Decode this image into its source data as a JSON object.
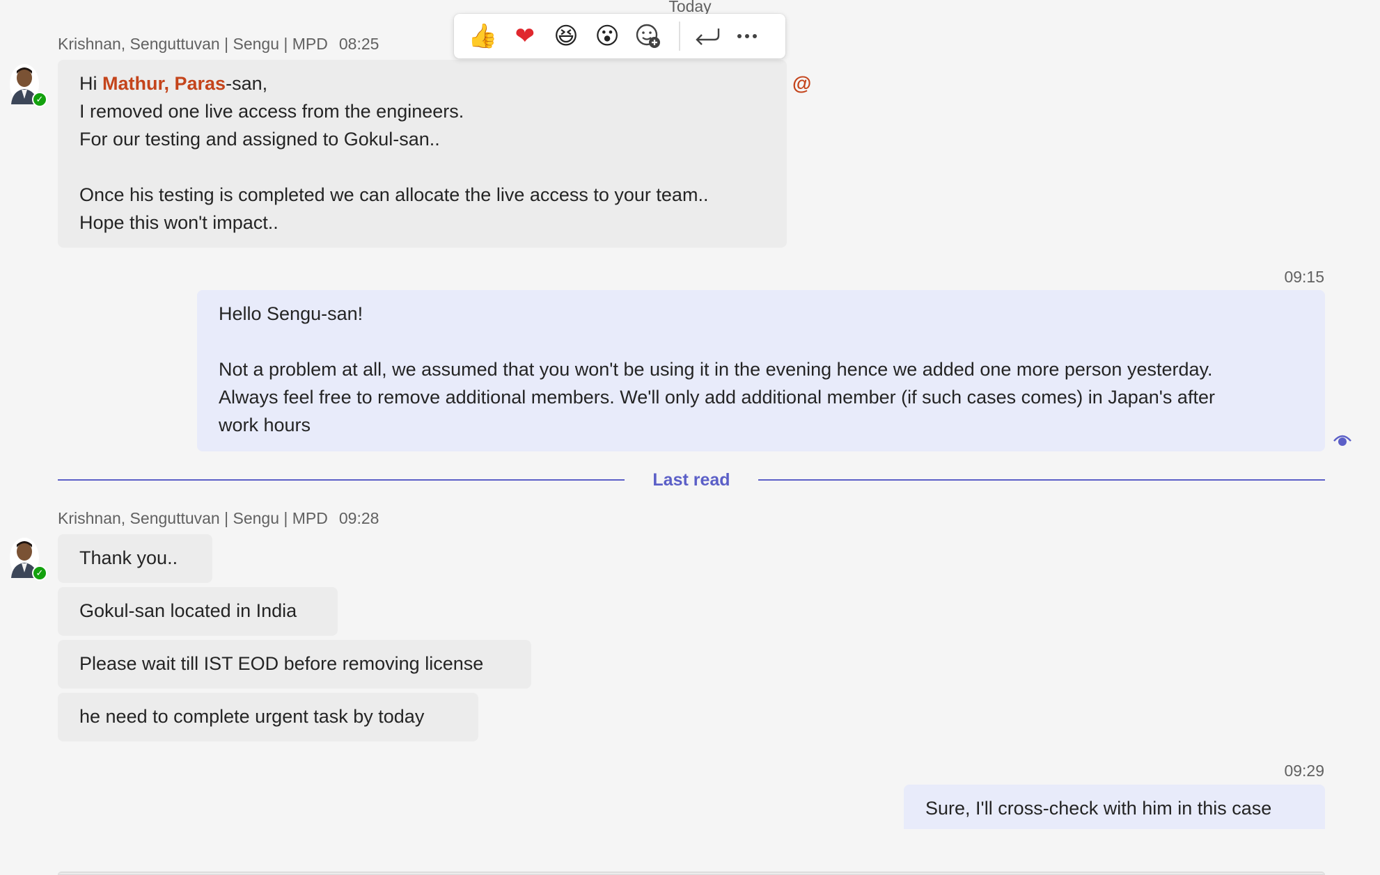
{
  "header": {
    "date_label": "Today"
  },
  "reactions": {
    "emojis": [
      {
        "icon": "thumbs-up-icon",
        "glyph": "👍"
      },
      {
        "icon": "heart-icon",
        "glyph": "❤"
      },
      {
        "icon": "laughing-icon",
        "glyph": "😆"
      },
      {
        "icon": "surprised-icon",
        "glyph": "😮"
      }
    ]
  },
  "messages": [
    {
      "sender": "Krishnan, Senguttuvan | Sengu | MPD",
      "time": "08:25",
      "greeting_prefix": "Hi ",
      "mention": "Mathur, Paras",
      "greeting_suffix": "-san,",
      "lines": [
        "I removed one live access from the engineers.",
        "For our testing and assigned to Gokul-san..",
        "",
        "Once his testing is completed we can allocate the live access to your team..",
        "Hope this won't impact.."
      ],
      "mention_indicator": "@"
    },
    {
      "time": "09:15",
      "lines": [
        "Hello Sengu-san!",
        "",
        "Not a problem at all, we assumed that you won't be using it in the evening hence we added one more person yesterday.",
        "Always feel free to remove additional members. We'll only add additional member (if such cases comes) in Japan's after",
        "work hours"
      ]
    }
  ],
  "last_read_label": "Last read",
  "group2": {
    "sender": "Krishnan, Senguttuvan | Sengu | MPD",
    "time": "09:28",
    "bubbles": [
      "Thank you..",
      "Gokul-san located in India",
      "Please wait till IST EOD before removing license",
      "he need to complete urgent task by today"
    ]
  },
  "reply": {
    "time": "09:29",
    "text": "Sure, I'll cross-check with him in this case"
  },
  "colors": {
    "accent": "#5b5fc7",
    "mention": "#c4441b",
    "presence": "#13a10e",
    "outgoing_bubble": "#e8ebfa",
    "incoming_bubble": "#ececec"
  }
}
